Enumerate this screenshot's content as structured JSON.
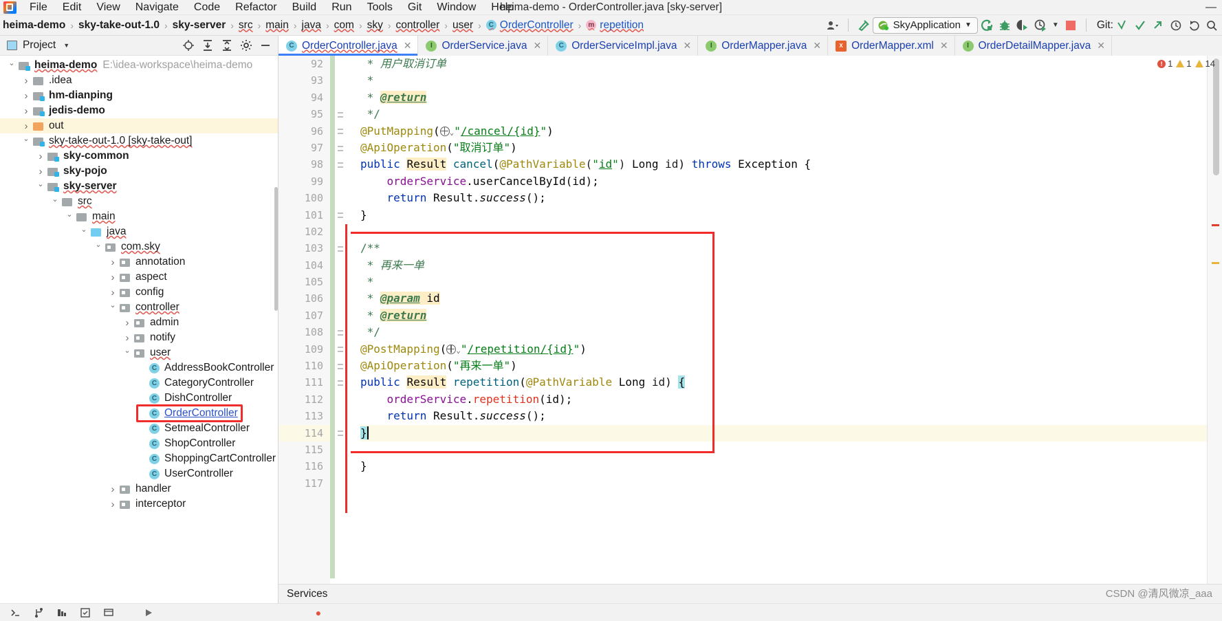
{
  "window": {
    "title": "heima-demo - OrderController.java [sky-server]",
    "minimize": "—",
    "maximize": "□",
    "close": "✕"
  },
  "menu": [
    {
      "label": "File"
    },
    {
      "label": "Edit"
    },
    {
      "label": "View"
    },
    {
      "label": "Navigate"
    },
    {
      "label": "Code"
    },
    {
      "label": "Refactor"
    },
    {
      "label": "Build"
    },
    {
      "label": "Run"
    },
    {
      "label": "Tools"
    },
    {
      "label": "Git"
    },
    {
      "label": "Window"
    },
    {
      "label": "Help"
    }
  ],
  "breadcrumb": {
    "items": [
      {
        "label": "heima-demo",
        "style": "bold"
      },
      {
        "label": "sky-take-out-1.0",
        "style": "bold"
      },
      {
        "label": "sky-server",
        "style": "bold"
      },
      {
        "label": "src",
        "style": "wavy"
      },
      {
        "label": "main",
        "style": "wavy"
      },
      {
        "label": "java",
        "style": "wavy"
      },
      {
        "label": "com",
        "style": "wavy"
      },
      {
        "label": "sky",
        "style": "wavy"
      },
      {
        "label": "controller",
        "style": "wavy"
      },
      {
        "label": "user",
        "style": "wavy"
      },
      {
        "label": "OrderController",
        "style": "class-link",
        "badge": "C"
      },
      {
        "label": "repetition",
        "style": "method-link",
        "badge": "m"
      }
    ],
    "separator": "›"
  },
  "toolbar": {
    "profile_icon": "user-profile-icon",
    "hammer_icon": "build-hammer-icon",
    "run_config": {
      "name": "SkyApplication",
      "icon": "spring-boot-icon",
      "caret": "▼"
    },
    "run_icon": "run-icon",
    "debug_icon": "debug-bug-icon",
    "coverage_icon": "run-with-coverage-icon",
    "profiler_icon": "run-with-profiler-icon",
    "profiler_caret": "▼",
    "stop_icon": "stop-icon",
    "git_label": "Git:",
    "git_update_icon": "git-update-icon",
    "git_commit_icon": "git-commit-icon",
    "git_push_icon": "git-push-icon",
    "history_icon": "history-icon",
    "undo_icon": "undo-icon",
    "search_icon": "search-icon"
  },
  "project_panel": {
    "title": "Project",
    "caret": "▼",
    "icons": [
      "locate-icon",
      "expand-all-icon",
      "collapse-all-icon",
      "settings-gear-icon",
      "hide-icon"
    ],
    "tree": [
      {
        "label": "heima-demo",
        "suffix": "E:\\idea-workspace\\heima-demo",
        "depth": 0,
        "arrow": "open",
        "icon": "mod",
        "style": "bold wavy"
      },
      {
        "label": ".idea",
        "depth": 1,
        "arrow": "closed",
        "icon": "fold",
        "style": ""
      },
      {
        "label": "hm-dianping",
        "depth": 1,
        "arrow": "closed",
        "icon": "mod",
        "style": "bold"
      },
      {
        "label": "jedis-demo",
        "depth": 1,
        "arrow": "closed",
        "icon": "mod",
        "style": "bold"
      },
      {
        "label": "out",
        "depth": 1,
        "arrow": "closed",
        "icon": "out",
        "style": "",
        "highlighted": true
      },
      {
        "label": "sky-take-out-1.0 [sky-take-out]",
        "depth": 1,
        "arrow": "open",
        "icon": "mod",
        "style": "wavy"
      },
      {
        "label": "sky-common",
        "depth": 2,
        "arrow": "closed",
        "icon": "mod",
        "style": "bold"
      },
      {
        "label": "sky-pojo",
        "depth": 2,
        "arrow": "closed",
        "icon": "mod",
        "style": "bold"
      },
      {
        "label": "sky-server",
        "depth": 2,
        "arrow": "open",
        "icon": "mod",
        "style": "bold wavy"
      },
      {
        "label": "src",
        "depth": 3,
        "arrow": "open",
        "icon": "fold",
        "style": "wavy"
      },
      {
        "label": "main",
        "depth": 4,
        "arrow": "open",
        "icon": "fold",
        "style": "wavy"
      },
      {
        "label": "java",
        "depth": 5,
        "arrow": "open",
        "icon": "src",
        "style": "wavy"
      },
      {
        "label": "com.sky",
        "depth": 6,
        "arrow": "open",
        "icon": "pkg",
        "style": "wavy"
      },
      {
        "label": "annotation",
        "depth": 7,
        "arrow": "closed",
        "icon": "pkg",
        "style": ""
      },
      {
        "label": "aspect",
        "depth": 7,
        "arrow": "closed",
        "icon": "pkg",
        "style": ""
      },
      {
        "label": "config",
        "depth": 7,
        "arrow": "closed",
        "icon": "pkg",
        "style": ""
      },
      {
        "label": "controller",
        "depth": 7,
        "arrow": "open",
        "icon": "pkg",
        "style": "wavy"
      },
      {
        "label": "admin",
        "depth": 8,
        "arrow": "closed",
        "icon": "pkg",
        "style": ""
      },
      {
        "label": "notify",
        "depth": 8,
        "arrow": "closed",
        "icon": "pkg",
        "style": ""
      },
      {
        "label": "user",
        "depth": 8,
        "arrow": "open",
        "icon": "pkg",
        "style": "wavy"
      },
      {
        "label": "AddressBookController",
        "depth": 9,
        "arrow": "none",
        "icon": "cls",
        "style": ""
      },
      {
        "label": "CategoryController",
        "depth": 9,
        "arrow": "none",
        "icon": "cls",
        "style": ""
      },
      {
        "label": "DishController",
        "depth": 9,
        "arrow": "none",
        "icon": "cls",
        "style": ""
      },
      {
        "label": "OrderController",
        "depth": 9,
        "arrow": "none",
        "icon": "cls",
        "style": "link wavy",
        "boxed": true
      },
      {
        "label": "SetmealController",
        "depth": 9,
        "arrow": "none",
        "icon": "cls",
        "style": ""
      },
      {
        "label": "ShopController",
        "depth": 9,
        "arrow": "none",
        "icon": "cls",
        "style": ""
      },
      {
        "label": "ShoppingCartController",
        "depth": 9,
        "arrow": "none",
        "icon": "cls",
        "style": ""
      },
      {
        "label": "UserController",
        "depth": 9,
        "arrow": "none",
        "icon": "cls",
        "style": ""
      },
      {
        "label": "handler",
        "depth": 7,
        "arrow": "closed",
        "icon": "pkg",
        "style": ""
      },
      {
        "label": "interceptor",
        "depth": 7,
        "arrow": "closed",
        "icon": "pkg",
        "style": ""
      }
    ]
  },
  "editor_tabs": [
    {
      "label": "OrderController.java",
      "badge": "C",
      "badge_kind": "class",
      "active": true,
      "close": "✕"
    },
    {
      "label": "OrderService.java",
      "badge": "I",
      "badge_kind": "interface",
      "active": false,
      "close": "✕"
    },
    {
      "label": "OrderServiceImpl.java",
      "badge": "C",
      "badge_kind": "class",
      "active": false,
      "close": "✕"
    },
    {
      "label": "OrderMapper.java",
      "badge": "I",
      "badge_kind": "interface",
      "active": false,
      "close": "✕"
    },
    {
      "label": "OrderMapper.xml",
      "badge": "X",
      "badge_kind": "xml",
      "active": false,
      "close": "✕"
    },
    {
      "label": "OrderDetailMapper.java",
      "badge": "I",
      "badge_kind": "interface",
      "active": false,
      "close": "✕"
    }
  ],
  "inspection_status": {
    "error_count": "1",
    "warning_count": "1",
    "weak_warning_count": "14",
    "error_icon": "error-circle-icon",
    "warning_icon": "warning-triangle-icon"
  },
  "code": {
    "first_line_number": 92,
    "lines": [
      {
        "n": 92,
        "text": " * 用户取消订单"
      },
      {
        "n": 93,
        "text": " *"
      },
      {
        "n": 94,
        "text": " * @return"
      },
      {
        "n": 95,
        "text": " */"
      },
      {
        "n": 96,
        "text": "@PutMapping(\"/cancel/{id}\")"
      },
      {
        "n": 97,
        "text": "@ApiOperation(\"取消订单\")"
      },
      {
        "n": 98,
        "text": "public Result cancel(@PathVariable(\"id\") Long id) throws Exception {"
      },
      {
        "n": 99,
        "text": "    orderService.userCancelById(id);"
      },
      {
        "n": 100,
        "text": "    return Result.success();"
      },
      {
        "n": 101,
        "text": "}"
      },
      {
        "n": 102,
        "text": ""
      },
      {
        "n": 103,
        "text": "/**"
      },
      {
        "n": 104,
        "text": " * 再来一单"
      },
      {
        "n": 105,
        "text": " *"
      },
      {
        "n": 106,
        "text": " * @param id"
      },
      {
        "n": 107,
        "text": " * @return"
      },
      {
        "n": 108,
        "text": " */"
      },
      {
        "n": 109,
        "text": "@PostMapping(\"/repetition/{id}\")"
      },
      {
        "n": 110,
        "text": "@ApiOperation(\"再来一单\")"
      },
      {
        "n": 111,
        "text": "public Result repetition(@PathVariable Long id) {"
      },
      {
        "n": 112,
        "text": "    orderService.repetition(id);"
      },
      {
        "n": 113,
        "text": "    return Result.success();"
      },
      {
        "n": 114,
        "text": "}"
      },
      {
        "n": 115,
        "text": ""
      },
      {
        "n": 116,
        "text": "}"
      },
      {
        "n": 117,
        "text": ""
      }
    ]
  },
  "status_bar": {
    "services_label": "Services"
  },
  "watermark": {
    "text": "CSDN @清风微凉_aaa"
  },
  "colors": {
    "accent_blue": "#3d7ff5",
    "highlight_box_red": "#f32a2a",
    "keyword": "#0033b3",
    "annotation": "#9e880d",
    "string": "#067d17",
    "javadoc": "#3d7a4f",
    "field": "#871094",
    "error": "#e0301e",
    "tab_highlight": "#fdf6dd"
  }
}
